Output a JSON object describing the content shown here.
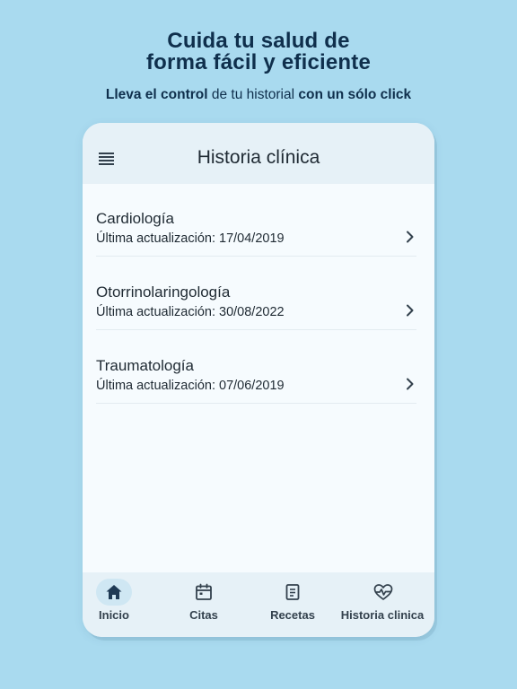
{
  "promo": {
    "headline_line1": "Cuida tu salud de",
    "headline_line2": "forma fácil y eficiente",
    "sub_bold1": "Lleva el control",
    "sub_normal": " de tu historial ",
    "sub_bold2": "con un sólo click"
  },
  "header": {
    "title": "Historia clínica",
    "menu_icon": "hamburger-menu-icon"
  },
  "records": [
    {
      "title": "Cardiología",
      "updated": "Última actualización: 17/04/2019"
    },
    {
      "title": "Otorrinolaringología",
      "updated": "Última actualización: 30/08/2022"
    },
    {
      "title": "Traumatología",
      "updated": "Última actualización: 07/06/2019"
    }
  ],
  "nav": [
    {
      "label": "Inicio",
      "icon": "home-icon",
      "active": true
    },
    {
      "label": "Citas",
      "icon": "calendar-icon",
      "active": false
    },
    {
      "label": "Recetas",
      "icon": "document-icon",
      "active": false
    },
    {
      "label": "Historia clinica",
      "icon": "heart-pulse-icon",
      "active": false
    }
  ],
  "colors": {
    "background": "#a9daef",
    "text_dark": "#0f2f4c",
    "header_bg": "#e6f1f7",
    "active_pill": "#cfe7f3"
  }
}
